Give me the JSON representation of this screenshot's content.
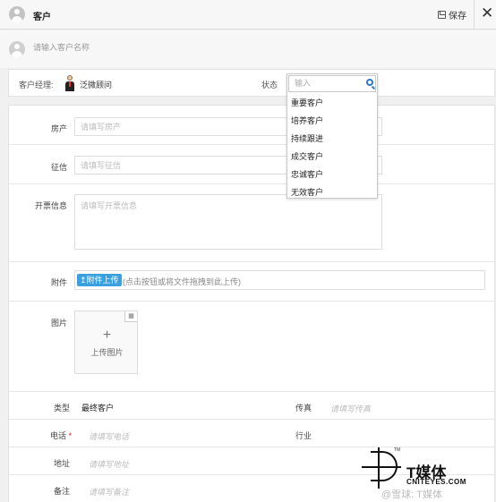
{
  "header": {
    "title": "客户",
    "save_label": "保存",
    "close_label": "✕"
  },
  "name_bar": {
    "placeholder": "请输入客户名称"
  },
  "manager_bar": {
    "manager_label": "客户经理:",
    "manager_name": "泛微顾问",
    "status_label": "状态"
  },
  "status_dropdown": {
    "search_placeholder": "输入",
    "options": [
      "重要客户",
      "培养客户",
      "持续跟进",
      "成交客户",
      "忠诚客户",
      "无效客户"
    ]
  },
  "form": {
    "property": {
      "label": "房产",
      "placeholder": "请填写房产"
    },
    "credit": {
      "label": "征信",
      "placeholder": "请填写征信"
    },
    "invoice": {
      "label": "开票信息",
      "placeholder": "请填写开票信息"
    },
    "attachment": {
      "label": "附件",
      "button": "附件上传",
      "hint": "(点击按钮或将文件拖拽到此上传)"
    },
    "image": {
      "label": "图片",
      "upload_label": "上传图片",
      "plus": "+"
    },
    "type": {
      "label": "类型",
      "value": "最终客户"
    },
    "fax": {
      "label": "传真",
      "placeholder": "请填写传真"
    },
    "phone": {
      "label": "电话",
      "required_mark": "*",
      "placeholder": "请填写电话"
    },
    "industry": {
      "label": "行业"
    },
    "address": {
      "label": "地址",
      "placeholder": "请填写地址"
    },
    "remark": {
      "label": "备注",
      "placeholder": "请填写备注"
    }
  },
  "watermark": {
    "brand_cn": "T媒体",
    "brand_en": "CNITEYES.COM",
    "tm": "TM",
    "sub": "@雪球: T媒体"
  }
}
